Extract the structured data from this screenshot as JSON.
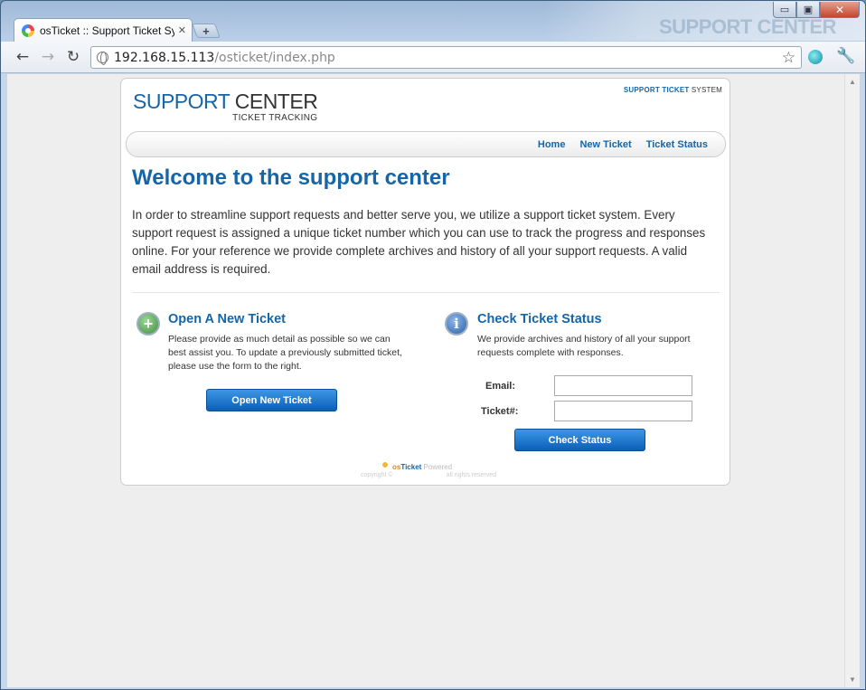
{
  "browser": {
    "tab_title": "osTicket :: Support Ticket Sy",
    "tab_close": "✕",
    "new_tab": "+",
    "url_host": "192.168.15.113",
    "url_path": "/osticket/index.php",
    "ghost_text": "SUPPORT CENTER",
    "controls": {
      "minimize": "▭",
      "maximize": "▣",
      "close": "✕"
    },
    "icons": {
      "back": "back-arrow-icon",
      "forward": "forward-arrow-icon",
      "reload": "reload-icon",
      "star": "bookmark-star-icon",
      "wrench": "wrench-icon"
    }
  },
  "page": {
    "logo_support": "SUPPORT",
    "logo_center": "CENTER",
    "logo_sub": "TICKET TRACKING",
    "sys_label_bold": "SUPPORT TICKET",
    "sys_label_rest": "SYSTEM",
    "nav": {
      "home": "Home",
      "new_ticket": "New Ticket",
      "ticket_status": "Ticket Status"
    },
    "welcome": "Welcome to the support center",
    "intro": "In order to streamline support requests and better serve you, we utilize a support ticket system. Every support request is assigned a unique ticket number which you can use to track the progress and responses online. For your reference we provide complete archives and history of all your support requests. A valid email address is required.",
    "open": {
      "title": "Open A New Ticket",
      "text": "Please provide as much detail as possible so we can best assist you. To update a previously submitted ticket, please use the form to the right.",
      "button": "Open New Ticket"
    },
    "check": {
      "title": "Check Ticket Status",
      "text": "We provide archives and history of all your support requests complete with responses.",
      "email_label": "Email:",
      "email_value": "",
      "ticket_label": "Ticket#:",
      "ticket_value": "",
      "button": "Check Status"
    },
    "footer": {
      "os": "os",
      "ticket": "Ticket",
      "powered": " Powered",
      "copyright": "copyright ©",
      "rights": "all rights reserved"
    }
  },
  "colors": {
    "brand_blue": "#1565a8",
    "button_blue": "#0a5fb7",
    "background": "#eeeeee"
  }
}
